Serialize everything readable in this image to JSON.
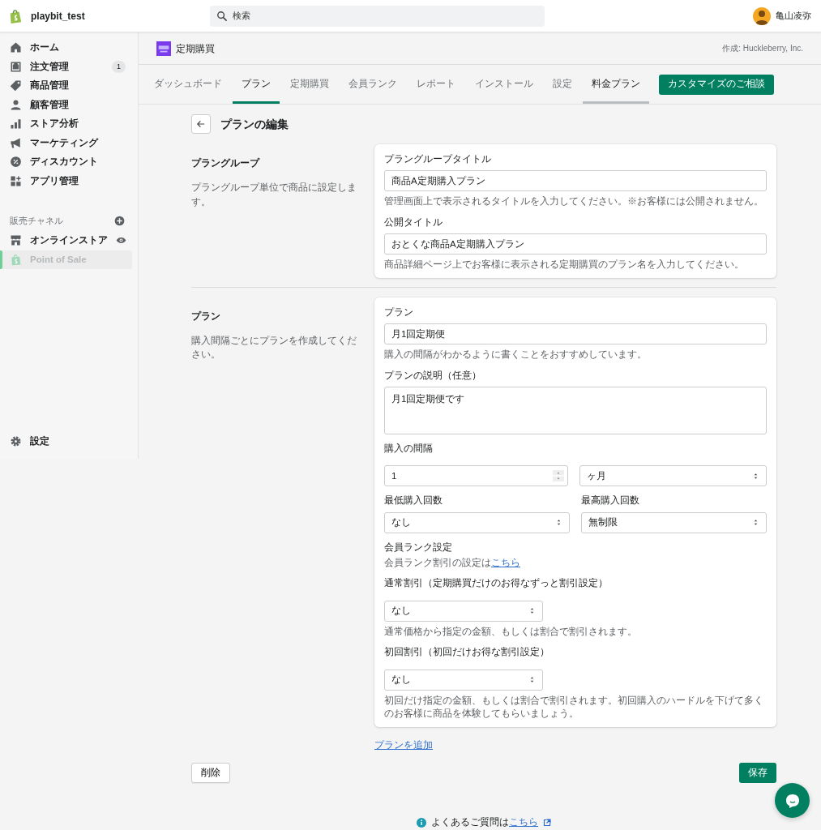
{
  "topbar": {
    "store_name": "playbit_test",
    "search": {
      "placeholder": "検索"
    },
    "user_name": "亀山凌弥"
  },
  "sidebar": {
    "items": [
      {
        "label": "ホーム",
        "selected": false
      },
      {
        "label": "注文管理",
        "selected": false,
        "badge": "1"
      },
      {
        "label": "商品管理",
        "selected": false
      },
      {
        "label": "顧客管理",
        "selected": false
      },
      {
        "label": "ストア分析",
        "selected": false
      },
      {
        "label": "マーケティング",
        "selected": false
      },
      {
        "label": "ディスカウント",
        "selected": false
      },
      {
        "label": "アプリ管理",
        "selected": false
      }
    ],
    "channels_heading": "販売チャネル",
    "channels": [
      {
        "label": "オンラインストア",
        "selected": false,
        "disabled": false
      },
      {
        "label": "Point of Sale",
        "selected": true,
        "disabled": true
      }
    ],
    "settings": {
      "label": "設定"
    }
  },
  "app_header": {
    "title": "定期購買",
    "credit": "作成: Huckleberry, Inc."
  },
  "tabs": [
    {
      "label": "ダッシュボード",
      "selected": false,
      "hovered": false
    },
    {
      "label": "プラン",
      "selected": true,
      "hovered": false
    },
    {
      "label": "定期購買",
      "selected": false,
      "hovered": false
    },
    {
      "label": "会員ランク",
      "selected": false,
      "hovered": false
    },
    {
      "label": "レポート",
      "selected": false,
      "hovered": false
    },
    {
      "label": "インストール",
      "selected": false,
      "hovered": false
    },
    {
      "label": "設定",
      "selected": false,
      "hovered": false
    },
    {
      "label": "料金プラン",
      "selected": false,
      "hovered": true
    }
  ],
  "cta_button": "カスタマイズのご相談",
  "page_title": "プランの編集",
  "sections": [
    {
      "title": "プラングループ",
      "description": "プラングループ単位で商品に設定します。",
      "fields": [
        {
          "kind": "text",
          "label": "プラングループタイトル",
          "value": "商品A定期購入プラン",
          "help": "管理画面上で表示されるタイトルを入力してください。※お客様には公開されません。"
        },
        {
          "kind": "text",
          "label": "公開タイトル",
          "value": "おとくな商品A定期購入プラン",
          "help": "商品詳細ページ上でお客様に表示される定期購買のプラン名を入力してください。"
        }
      ]
    },
    {
      "title": "プラン",
      "description": "購入間隔ごとにプランを作成してください。",
      "fields": [
        {
          "kind": "text",
          "label": "プラン",
          "value": "月1回定期便",
          "help": "購入の間隔がわかるように書くことをおすすめしています。"
        },
        {
          "kind": "textarea",
          "label": "プランの説明（任意）",
          "value": "月1回定期便です"
        },
        {
          "kind": "number_select",
          "label": "購入の間隔",
          "number": "1",
          "unit": "ヶ月"
        },
        {
          "kind": "select_pair",
          "items": [
            {
              "label": "最低購入回数",
              "value": "なし"
            },
            {
              "label": "最高購入回数",
              "value": "無制限"
            }
          ]
        },
        {
          "kind": "link_note",
          "label": "会員ランク設定",
          "text": "会員ランク割引の設定は",
          "link": "こちら"
        },
        {
          "kind": "select",
          "label": "通常割引（定期購買だけのお得なずっと割引設定）",
          "value": "なし",
          "help": "通常価格から指定の金額、もしくは割合で割引されます。"
        },
        {
          "kind": "select",
          "label": "初回割引（初回だけお得な割引設定）",
          "value": "なし",
          "help": "初回だけ指定の金額、もしくは割合で割引されます。初回購入のハードルを下げて多くのお客様に商品を体験してもらいましょう。"
        }
      ]
    }
  ],
  "add_plan_link": "プランを追加",
  "delete_button": "削除",
  "save_button": "保存",
  "footer": {
    "text": "よくあるご質問は",
    "link": "こちら"
  }
}
